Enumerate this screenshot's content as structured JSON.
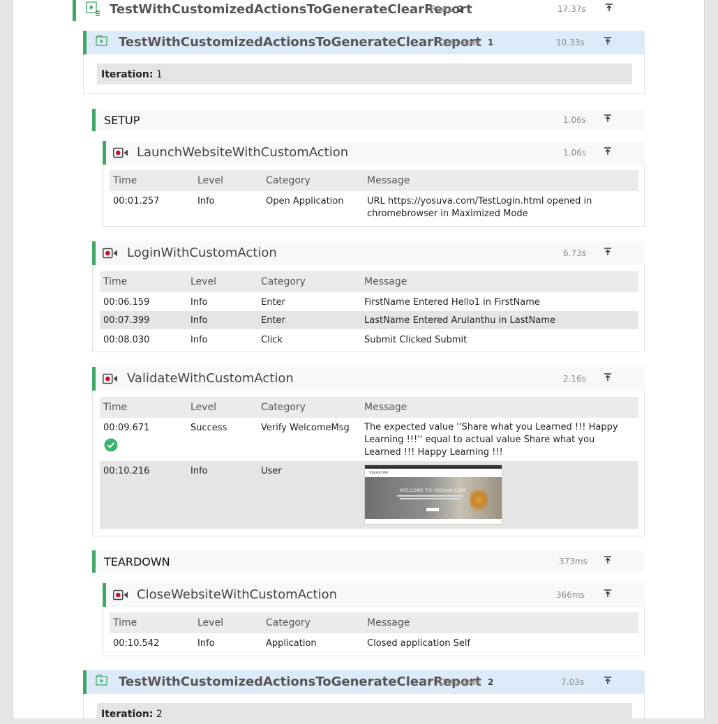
{
  "top_test": {
    "title": "TestWithCustomizedActionsToGenerateClearReport",
    "rows_label": "Rows:",
    "rows_value": "2",
    "duration": "17.37s"
  },
  "iteration1": {
    "title": "TestWithCustomizedActionsToGenerateClearReport",
    "data_row_label": "Data Row:",
    "data_row_value": "1",
    "duration": "10.33s",
    "iteration_label": "Iteration:",
    "iteration_value": "1"
  },
  "setup": {
    "label": "SETUP",
    "duration": "1.06s",
    "action": {
      "name": "LaunchWebsiteWithCustomAction",
      "duration": "1.06s",
      "headers": [
        "Time",
        "Level",
        "Category",
        "Message"
      ],
      "rows": [
        {
          "time": "00:01.257",
          "level": "Info",
          "category": "Open Application",
          "message": "URL https://yosuva.com/TestLogin.html opened in chromebrowser in Maximized Mode"
        }
      ]
    }
  },
  "login": {
    "name": "LoginWithCustomAction",
    "duration": "6.73s",
    "headers": [
      "Time",
      "Level",
      "Category",
      "Message"
    ],
    "rows": [
      {
        "time": "00:06.159",
        "level": "Info",
        "category": "Enter",
        "message": "FirstName Entered Hello1 in FirstName"
      },
      {
        "time": "00:07.399",
        "level": "Info",
        "category": "Enter",
        "message": "LastName Entered Arulanthu in LastName"
      },
      {
        "time": "00:08.030",
        "level": "Info",
        "category": "Click",
        "message": "Submit Clicked Submit"
      }
    ]
  },
  "validate": {
    "name": "ValidateWithCustomAction",
    "duration": "2.16s",
    "headers": [
      "Time",
      "Level",
      "Category",
      "Message"
    ],
    "rows": [
      {
        "time": "00:09.671",
        "level": "Success",
        "category": "Verify WelcomeMsg",
        "message": "The expected value ''Share what you Learned !!! Happy Learning !!!'' equal to actual value Share what you Learned !!! Happy Learning !!!"
      },
      {
        "time": "00:10.216",
        "level": "Info",
        "category": "User",
        "message": ""
      }
    ],
    "screenshot": {
      "site": "YOSUVA.COM",
      "headline": "WELCOME TO YOSUVA.COM"
    }
  },
  "teardown": {
    "label": "TEARDOWN",
    "duration": "373ms",
    "action": {
      "name": "CloseWebsiteWithCustomAction",
      "duration": "366ms",
      "headers": [
        "Time",
        "Level",
        "Category",
        "Message"
      ],
      "rows": [
        {
          "time": "00:10.542",
          "level": "Info",
          "category": "Application",
          "message": "Closed application Self"
        }
      ]
    }
  },
  "iteration2": {
    "title": "TestWithCustomizedActionsToGenerateClearReport",
    "data_row_label": "Data Row:",
    "data_row_value": "2",
    "duration": "7.03s",
    "iteration_label": "Iteration:",
    "iteration_value": "2"
  },
  "colors": {
    "accent_green": "#3fa865",
    "header_blue": "#ddeaf9",
    "record_red": "#c8102e",
    "success_green": "#3cb371"
  },
  "icons": {
    "collapse": "arrow-up-to-line-icon",
    "test": "play-file-icon",
    "action": "video-record-icon",
    "success": "check-circle-icon"
  }
}
